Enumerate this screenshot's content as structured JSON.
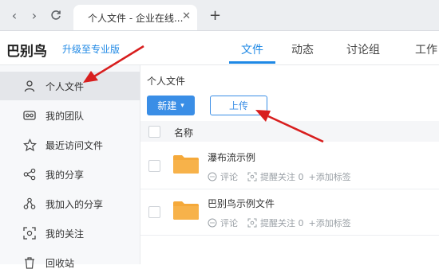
{
  "browser": {
    "tab_title": "个人文件 - 企业在线...",
    "tab_close": "✕",
    "new_tab": "+"
  },
  "header": {
    "logo": "巴别鸟",
    "upgrade": "升级至专业版",
    "nav": [
      {
        "label": "文件",
        "active": true
      },
      {
        "label": "动态",
        "active": false
      },
      {
        "label": "讨论组",
        "active": false
      },
      {
        "label": "工作",
        "active": false
      }
    ]
  },
  "sidebar": {
    "items": [
      {
        "label": "个人文件",
        "icon": "person-icon",
        "active": true
      },
      {
        "label": "我的团队",
        "icon": "team-icon",
        "active": false
      },
      {
        "label": "最近访问文件",
        "icon": "star-icon",
        "active": false
      },
      {
        "label": "我的分享",
        "icon": "share-icon",
        "active": false
      },
      {
        "label": "我加入的分享",
        "icon": "joined-share-icon",
        "active": false
      },
      {
        "label": "我的关注",
        "icon": "focus-icon",
        "active": false
      },
      {
        "label": "回收站",
        "icon": "trash-icon",
        "active": false
      }
    ]
  },
  "main": {
    "breadcrumb": "个人文件",
    "new_button": "新建",
    "new_caret": "▾",
    "upload_button": "上传",
    "column_name": "名称",
    "files": [
      {
        "name": "瀑布流示例",
        "comment": "评论",
        "remind": "提醒关注 0",
        "add_tag": "+添加标签"
      },
      {
        "name": "巴别鸟示例文件",
        "comment": "评论",
        "remind": "提醒关注 0",
        "add_tag": "+添加标签"
      }
    ]
  },
  "colors": {
    "accent": "#1e88e5",
    "annotation_arrow": "#d81e1e",
    "folder": "#f5a93a"
  }
}
